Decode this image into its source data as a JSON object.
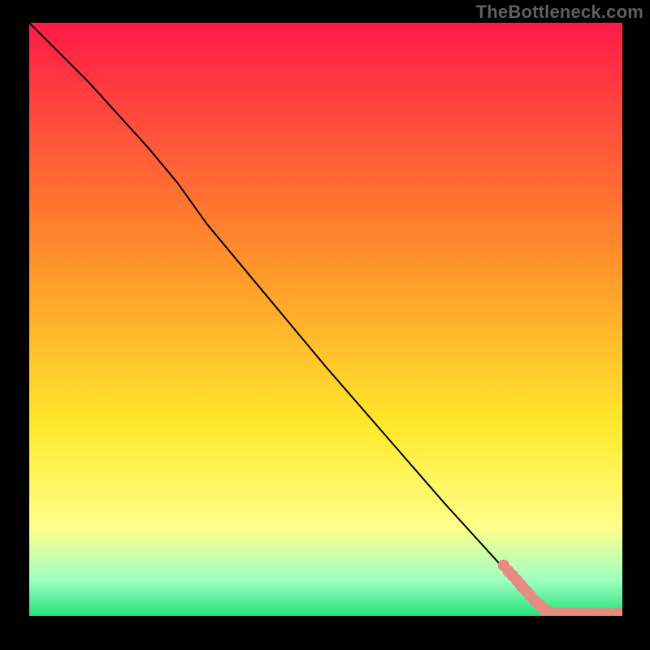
{
  "watermark": "TheBottleneck.com",
  "colors": {
    "frame_bg": "#000000",
    "gradient_top": "#ff1a49",
    "gradient_mid1": "#ff8b2b",
    "gradient_mid2": "#ffe92b",
    "gradient_low1": "#ffff8a",
    "gradient_low2": "#9effc2",
    "gradient_bottom": "#24e07a",
    "line": "#000000",
    "marker": "#e68a82"
  },
  "chart_data": {
    "type": "line",
    "title": "",
    "xlabel": "",
    "ylabel": "",
    "xlim": [
      0,
      100
    ],
    "ylim": [
      0,
      100
    ],
    "series": [
      {
        "name": "curve",
        "kind": "line",
        "x": [
          0,
          10,
          20,
          25,
          30,
          40,
          50,
          60,
          70,
          80,
          85,
          88,
          92,
          100
        ],
        "y": [
          100,
          90,
          79,
          73,
          66,
          54,
          42,
          30.5,
          19,
          8,
          3,
          0.8,
          0.6,
          0.6
        ]
      },
      {
        "name": "markers",
        "kind": "scatter",
        "points": [
          {
            "x": 80.0,
            "y": 8.5,
            "r": 1.2
          },
          {
            "x": 80.8,
            "y": 7.5,
            "r": 1.2
          },
          {
            "x": 81.5,
            "y": 6.8,
            "r": 1.2
          },
          {
            "x": 82.2,
            "y": 6.0,
            "r": 1.2
          },
          {
            "x": 82.8,
            "y": 5.3,
            "r": 1.2
          },
          {
            "x": 83.2,
            "y": 4.8,
            "r": 1.2
          },
          {
            "x": 83.8,
            "y": 4.2,
            "r": 1.2
          },
          {
            "x": 84.5,
            "y": 3.4,
            "r": 1.2
          },
          {
            "x": 85.2,
            "y": 2.6,
            "r": 1.2
          },
          {
            "x": 86.0,
            "y": 1.9,
            "r": 1.2
          },
          {
            "x": 86.6,
            "y": 1.3,
            "r": 1.2
          },
          {
            "x": 87.2,
            "y": 0.9,
            "r": 1.2
          },
          {
            "x": 88.0,
            "y": 0.7,
            "r": 1.0
          },
          {
            "x": 89.0,
            "y": 0.6,
            "r": 1.0
          },
          {
            "x": 90.0,
            "y": 0.6,
            "r": 1.0
          },
          {
            "x": 90.8,
            "y": 0.6,
            "r": 1.0
          },
          {
            "x": 91.8,
            "y": 0.6,
            "r": 1.0
          },
          {
            "x": 92.8,
            "y": 0.6,
            "r": 1.0
          },
          {
            "x": 93.8,
            "y": 0.6,
            "r": 1.0
          },
          {
            "x": 95.0,
            "y": 0.6,
            "r": 1.0
          },
          {
            "x": 96.2,
            "y": 0.6,
            "r": 1.0
          },
          {
            "x": 97.5,
            "y": 0.6,
            "r": 1.0
          },
          {
            "x": 99.0,
            "y": 0.6,
            "r": 1.0
          },
          {
            "x": 100.0,
            "y": 0.6,
            "r": 1.0
          }
        ]
      }
    ]
  }
}
